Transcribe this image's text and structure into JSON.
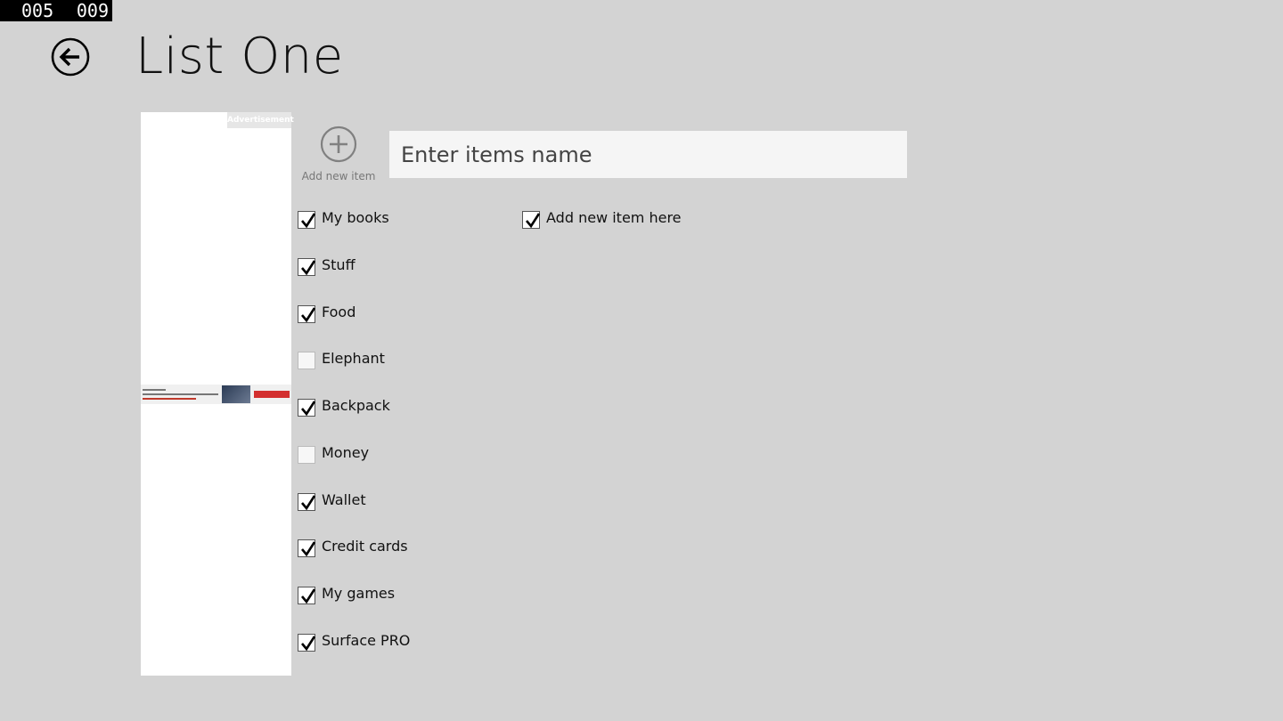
{
  "frame_counter": {
    "left": "005",
    "right": "009"
  },
  "header": {
    "title": "List One"
  },
  "ad": {
    "label": "Advertisement"
  },
  "add_item": {
    "label": "Add new item"
  },
  "input": {
    "placeholder": "Enter items name",
    "value": ""
  },
  "items": [
    {
      "label": "My books",
      "checked": true
    },
    {
      "label": "Stuff",
      "checked": true
    },
    {
      "label": "Food",
      "checked": true
    },
    {
      "label": "Elephant",
      "checked": false
    },
    {
      "label": "Backpack",
      "checked": true
    },
    {
      "label": "Money",
      "checked": false
    },
    {
      "label": "Wallet",
      "checked": true
    },
    {
      "label": "Credit cards",
      "checked": true
    },
    {
      "label": "My games",
      "checked": true
    },
    {
      "label": "Surface PRO",
      "checked": true
    }
  ],
  "items_col2": [
    {
      "label": "Add new item here",
      "checked": true
    }
  ]
}
